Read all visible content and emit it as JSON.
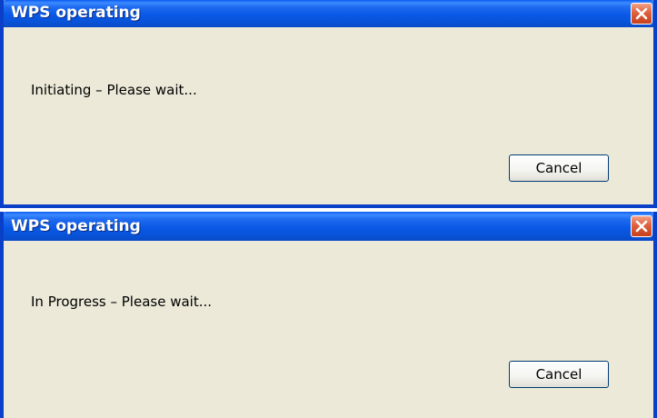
{
  "dialogs": [
    {
      "title": "WPS operating",
      "message": "Initiating – Please wait...",
      "cancel_label": "Cancel",
      "close_icon": "close-icon"
    },
    {
      "title": "WPS operating",
      "message": "In Progress – Please wait...",
      "cancel_label": "Cancel",
      "close_icon": "close-icon"
    }
  ],
  "colors": {
    "titlebar": "#0a58e6",
    "frame": "#0a40c8",
    "client": "#ece9d8",
    "close": "#e0603c"
  }
}
